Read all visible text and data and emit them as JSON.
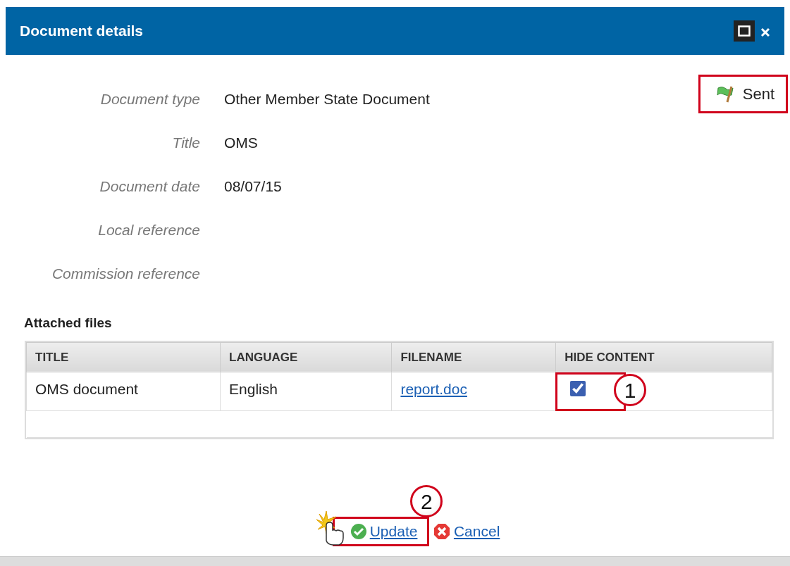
{
  "window": {
    "title": "Document details"
  },
  "status": {
    "label": "Sent",
    "highlighted": true
  },
  "fields": [
    {
      "label": "Document type",
      "value": "Other Member State Document"
    },
    {
      "label": "Title",
      "value": "OMS"
    },
    {
      "label": "Document date",
      "value": "08/07/15"
    },
    {
      "label": "Local reference"
    },
    {
      "label": "Commission reference"
    }
  ],
  "attached_files": {
    "heading": "Attached files",
    "columns": [
      "TITLE",
      "LANGUAGE",
      "FILENAME",
      "HIDE CONTENT"
    ],
    "rows": [
      {
        "title": "OMS document",
        "language": "English",
        "filename": "report.doc",
        "hide_content": true,
        "highlighted": true,
        "callout": "1"
      }
    ]
  },
  "actions": {
    "update": {
      "label": "Update",
      "highlighted": true,
      "callout": "2"
    },
    "cancel": {
      "label": "Cancel"
    }
  }
}
